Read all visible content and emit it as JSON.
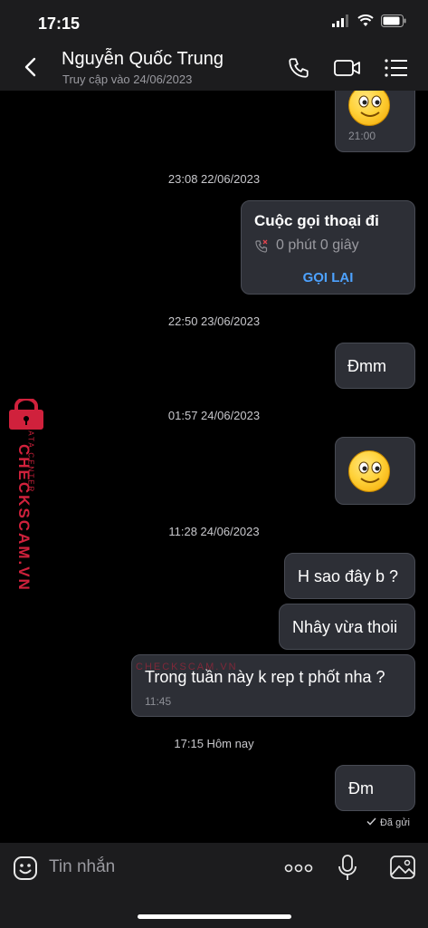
{
  "status_bar": {
    "time": "17:15"
  },
  "header": {
    "contact_name": "Nguyễn Quốc Trung",
    "last_seen": "Truy cập vào 24/06/2023"
  },
  "messages": {
    "m1_time": "21:00",
    "ts1": "23:08 22/06/2023",
    "call_title": "Cuộc gọi thoại đi",
    "call_duration": "0 phút 0 giây",
    "call_back": "GỌI LẠI",
    "ts2": "22:50 23/06/2023",
    "m3_text": "Đmm",
    "ts3": "01:57 24/06/2023",
    "ts4": "11:28 24/06/2023",
    "m5_text": "H sao đây b ?",
    "m6_text": "Nhây vừa thoii",
    "m7_text": "Trong tuần này k rep t phốt nha ?",
    "m7_time": "11:45",
    "ts5": "17:15 Hôm nay",
    "m8_text": "Đm",
    "sent_status": "Đã gửi"
  },
  "watermark": {
    "main": "CHECKSCAM.VN",
    "sub": "DATA CENTER",
    "inline": "CHECKSCAM.VN"
  },
  "input": {
    "placeholder": "Tin nhắn"
  },
  "colors": {
    "bg": "#000000",
    "bar": "#1c1c1e",
    "bubble": "#2d2f36",
    "accent_link": "#4da2ff",
    "watermark": "#d0213c"
  },
  "icons": [
    "back-icon",
    "phone-icon",
    "video-icon",
    "menu-icon",
    "emoji-icon",
    "more-icon",
    "mic-icon",
    "photo-icon"
  ]
}
